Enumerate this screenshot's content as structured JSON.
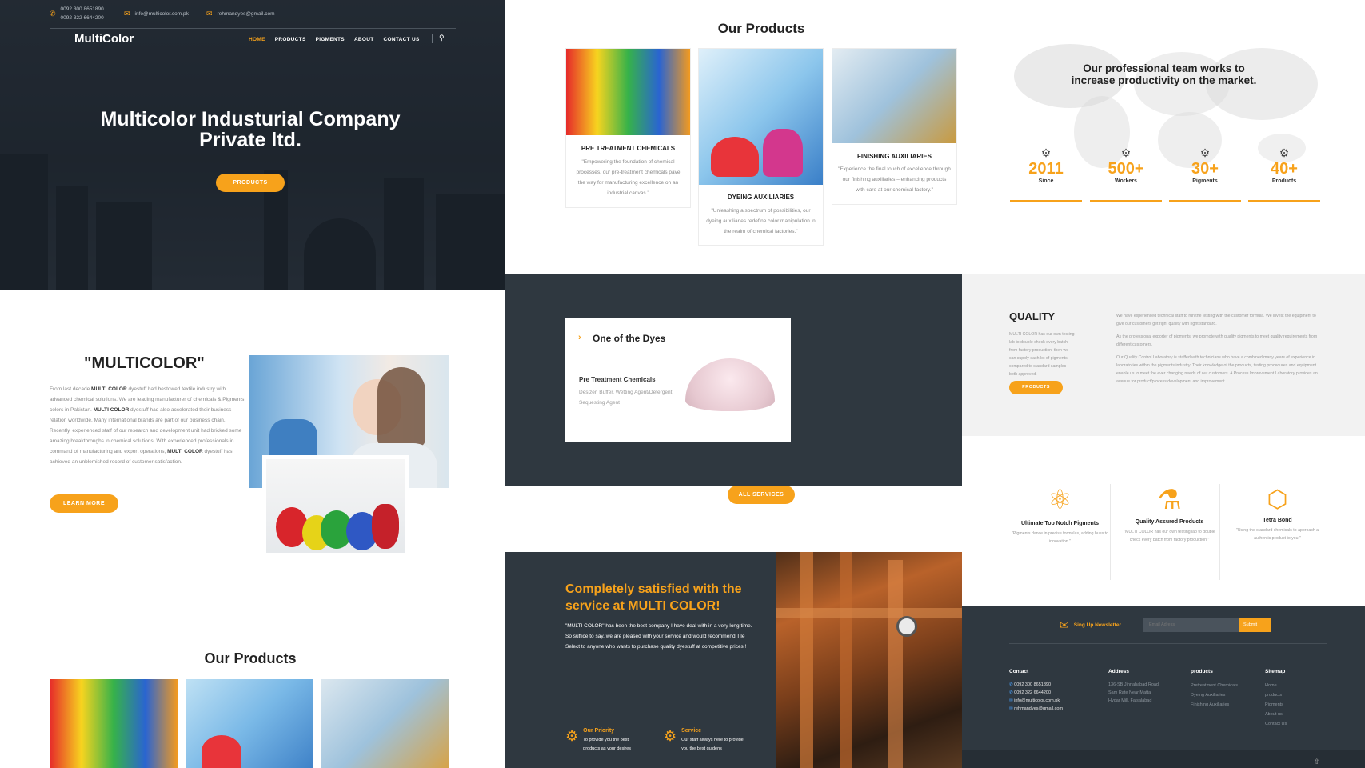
{
  "hero": {
    "phone1": "0092 300 8651890",
    "phone2": "0092 322 6644200",
    "email1": "info@multicolor.com.pk",
    "email2": "rehmandyes@gmail.com",
    "logo": "MultiColor",
    "nav": [
      "HOME",
      "PRODUCTS",
      "PIGMENTS",
      "ABOUT",
      "CONTACT US"
    ],
    "title_line1": "Multicolor Industurial Company",
    "title_line2": "Private ltd.",
    "button": "PRODUCTS"
  },
  "about": {
    "heading": "\"MULTICOLOR\"",
    "body_segments": [
      "From last decade ",
      "MULTI COLOR",
      " dyestuff had bestowed textile industry with advanced chemical solutions. We are leading manufacturer of chemicals & Pigments colors in Pakistan. ",
      "MULTI COLOR",
      " dyestuff had also accelerated their business relation worldwide. Many international brands are part of our business chain. Recently, experienced staff of our research and development unit had bricked some amazing breakthroughs in chemical solutions. With experienced professionals in command of manufacturing and export operations, ",
      "MULTI COLOR",
      " dyestuff has achieved an unblemished record of customer satisfaction."
    ],
    "button": "LEARN MORE"
  },
  "products": {
    "heading": "Our Products",
    "items": [
      {
        "title": "PRE TREATMENT CHEMICALS",
        "desc": "\"Empowering the foundation of chemical processes, our pre-treatment chemicals pave the way for manufacturing excellence on an industrial canvas.\""
      },
      {
        "title": "DYEING AUXILIARIES",
        "desc": "\"Unleashing a spectrum of possibilities, our dyeing auxiliaries redefine color manipulation in the realm of chemical factories.\""
      },
      {
        "title": "FINISHING AUXILIARIES",
        "desc": "\"Experience the final touch of excellence through our finishing auxiliaries – enhancing products with care at our chemical factory.\""
      }
    ]
  },
  "stats": {
    "heading_line1": "Our professional team works to",
    "heading_line2": "increase productivity on the market.",
    "items": [
      {
        "num": "2011",
        "label": "Since"
      },
      {
        "num": "500+",
        "label": "Workers"
      },
      {
        "num": "30+",
        "label": "Pigments"
      },
      {
        "num": "40+",
        "label": "Products"
      }
    ]
  },
  "dyes": {
    "title": "One of the Dyes",
    "sub": "Pre Treatment Chemicals",
    "desc_line1": "Desizer, Buffer, Wetting Agent/Detergent,",
    "desc_line2": "Sequesting Agent",
    "button": "ALL SERVICES"
  },
  "quality": {
    "heading": "QUALITY",
    "left_text": "MULTI COLOR has our own testing lab to double check every batch from factory production, then we can supply each lot of pigments compared to standard samples both approved.",
    "button": "PRODUCTS",
    "p1": "We have experienced technical staff to run the testing with the customer formula. We invest the equipment to give our customers get right quality with right standard.",
    "p2": "As the professional exporter of pigments, we promote with quality pigments to meet quality requirements from different customers.",
    "p3": "Our Quality Control Laboratory is staffed with technicians who have a combined many years of experience in laboratories within the pigments industry. Their knowledge of the products, testing procedures and equipment enable us to meet the ever changing needs of our customers. A Process Improvement Laboratory provides an avenue for product/process development and improvement."
  },
  "features": [
    {
      "title": "Ultimate Top Notch Pigments",
      "desc": "\"Pigments dance in precise formulas, adding hues to innovation.\""
    },
    {
      "title": "Quality Assured Products",
      "desc": "\"MULTI COLOR has our own testing lab to double check every batch from factory production.\""
    },
    {
      "title": "Tetra Bond",
      "desc": "\"Using the standard chemicals to approach a authentic product to you.\""
    }
  ],
  "satisfied": {
    "title_line1": "Completely satisfied with the",
    "title_line2": "service at MULTI COLOR!",
    "body": "\"MULTI COLOR\" has been the best company I have deal with in a very long time. So suffice to say, we are pleased with your service and would recommend Tile Select to anyone who wants to purchase quality dyestuff at competitive prices!!",
    "p1_title": "Our Priority",
    "p1_desc_l1": "To provide you the best",
    "p1_desc_l2": "products as your desires",
    "p2_title": "Service",
    "p2_desc_l1": "Our staff always here to provide",
    "p2_desc_l2": "you the best guidens"
  },
  "footer": {
    "newsletter_label": "Sing Up Newsletter",
    "email_placeholder": "Email Adress",
    "submit": "Submit",
    "contact_title": "Contact",
    "contacts": [
      "0092 300 8651890",
      "0092 322 6644200",
      "info@multicolor.com.pk",
      "rehmandyes@gmail.com"
    ],
    "address_title": "Address",
    "address": [
      "136-SB Jinnahabad Road,",
      "Sam Rate Near Mattal",
      "Hydar Mill, Faisalabad"
    ],
    "products_title": "products",
    "product_links": [
      "Pretreatment Chemicals",
      "Dyeing Auxiliaries",
      "Finishing Auxiliaries"
    ],
    "sitemap_title": "Sitemap",
    "sitemap_links": [
      "Home",
      "products",
      "Pigments",
      "About us",
      "Contact Us"
    ]
  },
  "colors": {
    "accent": "#f7a21b",
    "dark": "#2f3840"
  }
}
